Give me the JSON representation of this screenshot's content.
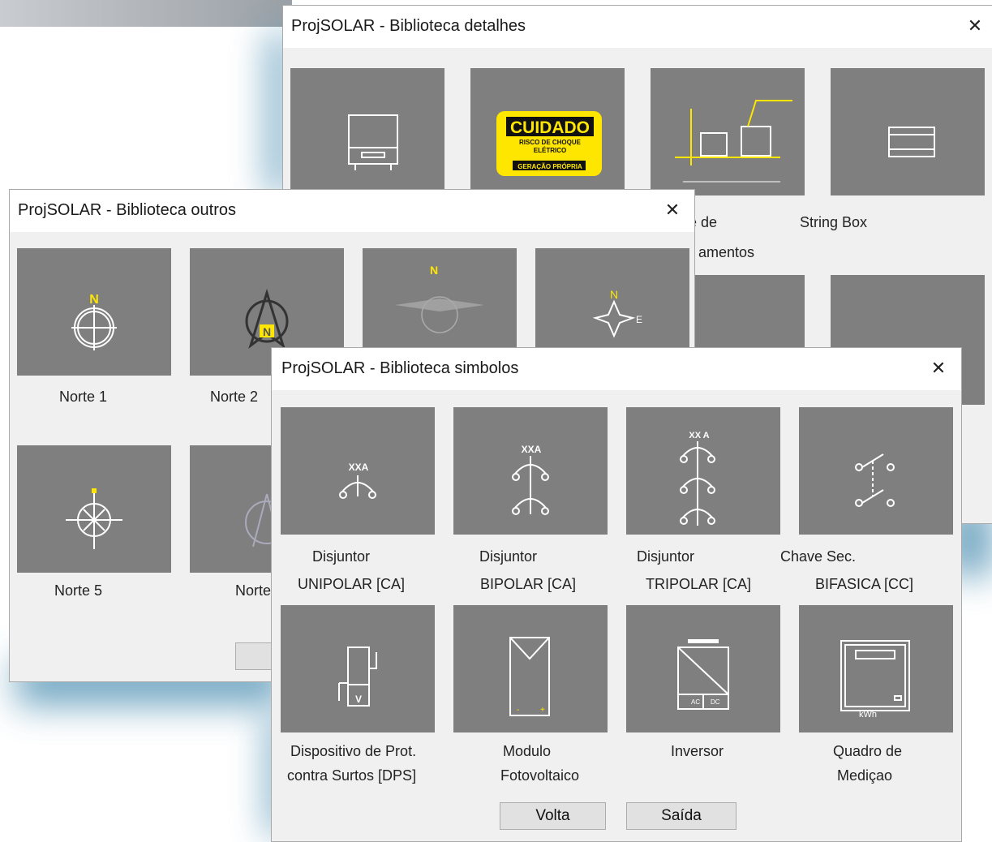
{
  "windows": {
    "detalhes": {
      "title": "ProjSOLAR - Biblioteca detalhes",
      "labels": {
        "partial_line1": "e de",
        "partial_line2": "amentos",
        "string_box": "String Box"
      },
      "sign": {
        "big": "CUIDADO",
        "line1": "RISCO DE CHOQUE",
        "line2": "ELÉTRICO",
        "line3": "GERAÇÃO PRÓPRIA"
      }
    },
    "outros": {
      "title": "ProjSOLAR - Biblioteca outros",
      "items": [
        "Norte 1",
        "Norte 2",
        "Norte 5",
        "Norte"
      ],
      "north_letter": "N",
      "east_letter": "E"
    },
    "simbolos": {
      "title": "ProjSOLAR - Biblioteca simbolos",
      "items": [
        {
          "line1": "Disjuntor",
          "line2": "UNIPOLAR [CA]",
          "icon": "breaker-unipolar-icon",
          "rating": "XXA"
        },
        {
          "line1": "Disjuntor",
          "line2": "BIPOLAR [CA]",
          "icon": "breaker-bipolar-icon",
          "rating": "XXA"
        },
        {
          "line1": "Disjuntor",
          "line2": "TRIPOLAR [CA]",
          "icon": "breaker-tripolar-icon",
          "rating": "XX A"
        },
        {
          "line1": "Chave Sec.",
          "line2": "BIFASICA [CC]",
          "icon": "switch-icon"
        },
        {
          "line1": "Dispositivo de Prot.",
          "line2": "contra Surtos [DPS]",
          "icon": "surge-protector-icon",
          "symbol": "V"
        },
        {
          "line1": "Modulo",
          "line2": "Fotovoltaico",
          "icon": "pv-module-icon"
        },
        {
          "line1": "Inversor",
          "line2": "",
          "icon": "inverter-icon",
          "ac": "AC",
          "dc": "DC"
        },
        {
          "line1": "Quadro de",
          "line2": "Mediçao",
          "icon": "meter-panel-icon",
          "unit": "kWh"
        }
      ],
      "buttons": {
        "back": "Volta",
        "exit": "Saída"
      }
    }
  },
  "colors": {
    "tile": "#7f7f7f",
    "window_bg": "#f0f0f0",
    "accent_yellow": "#ffe600",
    "shadow": "#5b98b8"
  }
}
